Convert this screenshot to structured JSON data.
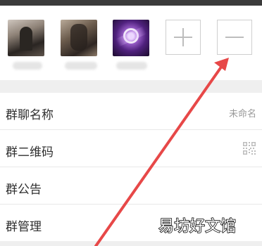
{
  "members": {
    "avatars": [
      {
        "name": "member-avatar"
      },
      {
        "name": "member-avatar"
      },
      {
        "name": "member-avatar"
      }
    ],
    "add_icon": "plus-icon",
    "remove_icon": "minus-icon"
  },
  "settings": {
    "rows": [
      {
        "label": "群聊名称",
        "value": "未命名"
      },
      {
        "label": "群二维码",
        "icon": "qr-code-icon"
      },
      {
        "label": "群公告"
      },
      {
        "label": "群管理"
      }
    ]
  },
  "watermark": {
    "text": "易坊好文馆"
  },
  "colors": {
    "arrow": "#e74848",
    "background": "#efefef",
    "row_background": "#ffffff"
  }
}
